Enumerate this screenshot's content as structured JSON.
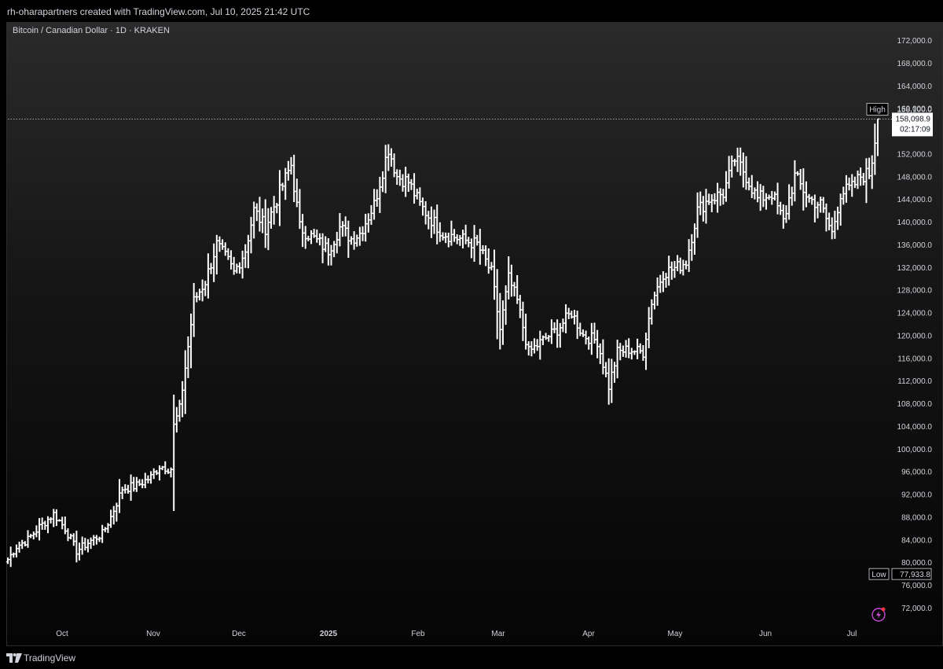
{
  "header": {
    "credit": "rh-oharapartners created with TradingView.com, Jul 10, 2025 21:42 UTC"
  },
  "chart_header": {
    "symbol": "Bitcoin / Canadian Dollar · 1D · KRAKEN"
  },
  "footer": {
    "brand": "TradingView"
  },
  "colors": {
    "bar": "#ffffff",
    "axis_text": "#d1d4dc",
    "accent": "#c848d8"
  },
  "chart_data": {
    "type": "ohlc",
    "title": "Bitcoin / Canadian Dollar · 1D · KRAKEN",
    "ylim": [
      68000,
      175000
    ],
    "y_ticks": [
      "172,000.0",
      "168,000.0",
      "164,000.0",
      "160,000.0",
      "156,000.0",
      "152,000.0",
      "148,000.0",
      "144,000.0",
      "140,000.0",
      "136,000.0",
      "132,000.0",
      "128,000.0",
      "124,000.0",
      "120,000.0",
      "116,000.0",
      "112,000.0",
      "108,000.0",
      "104,000.0",
      "100,000.0",
      "96,000.0",
      "92,000.0",
      "88,000.0",
      "84,000.0",
      "80,000.0",
      "76,000.0",
      "72,000.0"
    ],
    "x_labels": [
      "Oct",
      "Nov",
      "Dec",
      "2025",
      "Feb",
      "Mar",
      "Apr",
      "May",
      "Jun",
      "Jul"
    ],
    "date_range": [
      "2024-09-09",
      "2025-07-10"
    ],
    "grid": false,
    "high": {
      "label": "High",
      "value": "158,100.0"
    },
    "low": {
      "label": "Low",
      "value": "77,933.8"
    },
    "last": {
      "value": "158,098.9",
      "countdown": "02:17:09"
    },
    "anchors": [
      [
        "2024-09-09",
        80500
      ],
      [
        "2024-09-12",
        82800
      ],
      [
        "2024-09-16",
        84000
      ],
      [
        "2024-09-20",
        86200
      ],
      [
        "2024-09-25",
        88500
      ],
      [
        "2024-09-29",
        86000
      ],
      [
        "2024-10-03",
        82000
      ],
      [
        "2024-10-08",
        83800
      ],
      [
        "2024-10-12",
        85000
      ],
      [
        "2024-10-15",
        88000
      ],
      [
        "2024-10-19",
        93000
      ],
      [
        "2024-10-24",
        93500
      ],
      [
        "2024-10-29",
        95000
      ],
      [
        "2024-11-01",
        97000
      ],
      [
        "2024-11-05",
        96500
      ],
      [
        "2024-11-06",
        104000
      ],
      [
        "2024-11-08",
        107000
      ],
      [
        "2024-11-11",
        118000
      ],
      [
        "2024-11-13",
        126000
      ],
      [
        "2024-11-17",
        129500
      ],
      [
        "2024-11-21",
        136000
      ],
      [
        "2024-11-25",
        133000
      ],
      [
        "2024-11-27",
        131000
      ],
      [
        "2024-12-01",
        135000
      ],
      [
        "2024-12-04",
        142000
      ],
      [
        "2024-12-08",
        139000
      ],
      [
        "2024-12-12",
        144000
      ],
      [
        "2024-12-17",
        150000
      ],
      [
        "2024-12-20",
        139000
      ],
      [
        "2024-12-25",
        137000
      ],
      [
        "2024-12-30",
        135000
      ],
      [
        "2025-01-03",
        139000
      ],
      [
        "2025-01-07",
        137000
      ],
      [
        "2025-01-10",
        138000
      ],
      [
        "2025-01-15",
        143000
      ],
      [
        "2025-01-20",
        153000
      ],
      [
        "2025-01-23",
        148000
      ],
      [
        "2025-01-27",
        147000
      ],
      [
        "2025-01-31",
        143000
      ],
      [
        "2025-02-03",
        141000
      ],
      [
        "2025-02-08",
        138000
      ],
      [
        "2025-02-14",
        137000
      ],
      [
        "2025-02-20",
        136000
      ],
      [
        "2025-02-25",
        131000
      ],
      [
        "2025-02-28",
        121000
      ],
      [
        "2025-03-03",
        130000
      ],
      [
        "2025-03-06",
        126000
      ],
      [
        "2025-03-10",
        117000
      ],
      [
        "2025-03-16",
        119500
      ],
      [
        "2025-03-20",
        121000
      ],
      [
        "2025-03-25",
        124000
      ],
      [
        "2025-03-29",
        120000
      ],
      [
        "2025-04-03",
        119000
      ],
      [
        "2025-04-07",
        111000
      ],
      [
        "2025-04-10",
        117000
      ],
      [
        "2025-04-14",
        117500
      ],
      [
        "2025-04-19",
        117000
      ],
      [
        "2025-04-22",
        126000
      ],
      [
        "2025-04-26",
        131000
      ],
      [
        "2025-05-01",
        132000
      ],
      [
        "2025-05-04",
        133000
      ],
      [
        "2025-05-08",
        142000
      ],
      [
        "2025-05-12",
        144000
      ],
      [
        "2025-05-17",
        145000
      ],
      [
        "2025-05-21",
        151000
      ],
      [
        "2025-05-24",
        149000
      ],
      [
        "2025-05-29",
        144000
      ],
      [
        "2025-06-03",
        145000
      ],
      [
        "2025-06-07",
        140000
      ],
      [
        "2025-06-11",
        148000
      ],
      [
        "2025-06-16",
        144000
      ],
      [
        "2025-06-20",
        143000
      ],
      [
        "2025-06-24",
        138000
      ],
      [
        "2025-06-27",
        145000
      ],
      [
        "2025-07-01",
        146000
      ],
      [
        "2025-07-04",
        148000
      ],
      [
        "2025-07-07",
        148500
      ],
      [
        "2025-07-08",
        151000
      ],
      [
        "2025-07-10",
        158099
      ]
    ]
  }
}
